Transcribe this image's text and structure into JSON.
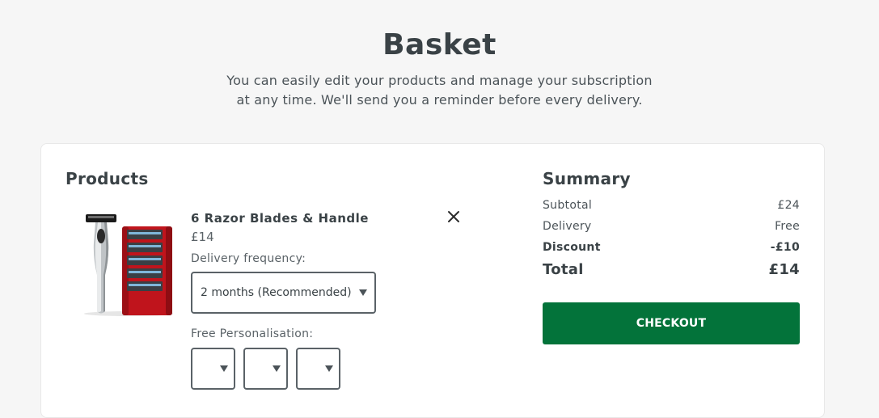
{
  "header": {
    "title": "Basket",
    "subtitle_line1": "You can easily edit your products and manage your subscription",
    "subtitle_line2": "at any time. We'll send you a reminder before every delivery."
  },
  "products": {
    "heading": "Products",
    "items": [
      {
        "name": "6 Razor Blades & Handle",
        "price": "£14",
        "delivery_label": "Delivery frequency:",
        "delivery_value": "2 months (Recommended)",
        "personalisation_label": "Free Personalisation:",
        "personalisation_slots": [
          "",
          "",
          ""
        ]
      }
    ]
  },
  "summary": {
    "heading": "Summary",
    "subtotal_label": "Subtotal",
    "subtotal_value": "£24",
    "delivery_label": "Delivery",
    "delivery_value": "Free",
    "discount_label": "Discount",
    "discount_value": "-£10",
    "total_label": "Total",
    "total_value": "£14",
    "checkout_label": "CHECKOUT"
  },
  "colors": {
    "page_background": "#f6f6f6",
    "checkout_green": "#03733a",
    "text_dark": "#3a4246",
    "blade_case_red": "#c0141c"
  }
}
